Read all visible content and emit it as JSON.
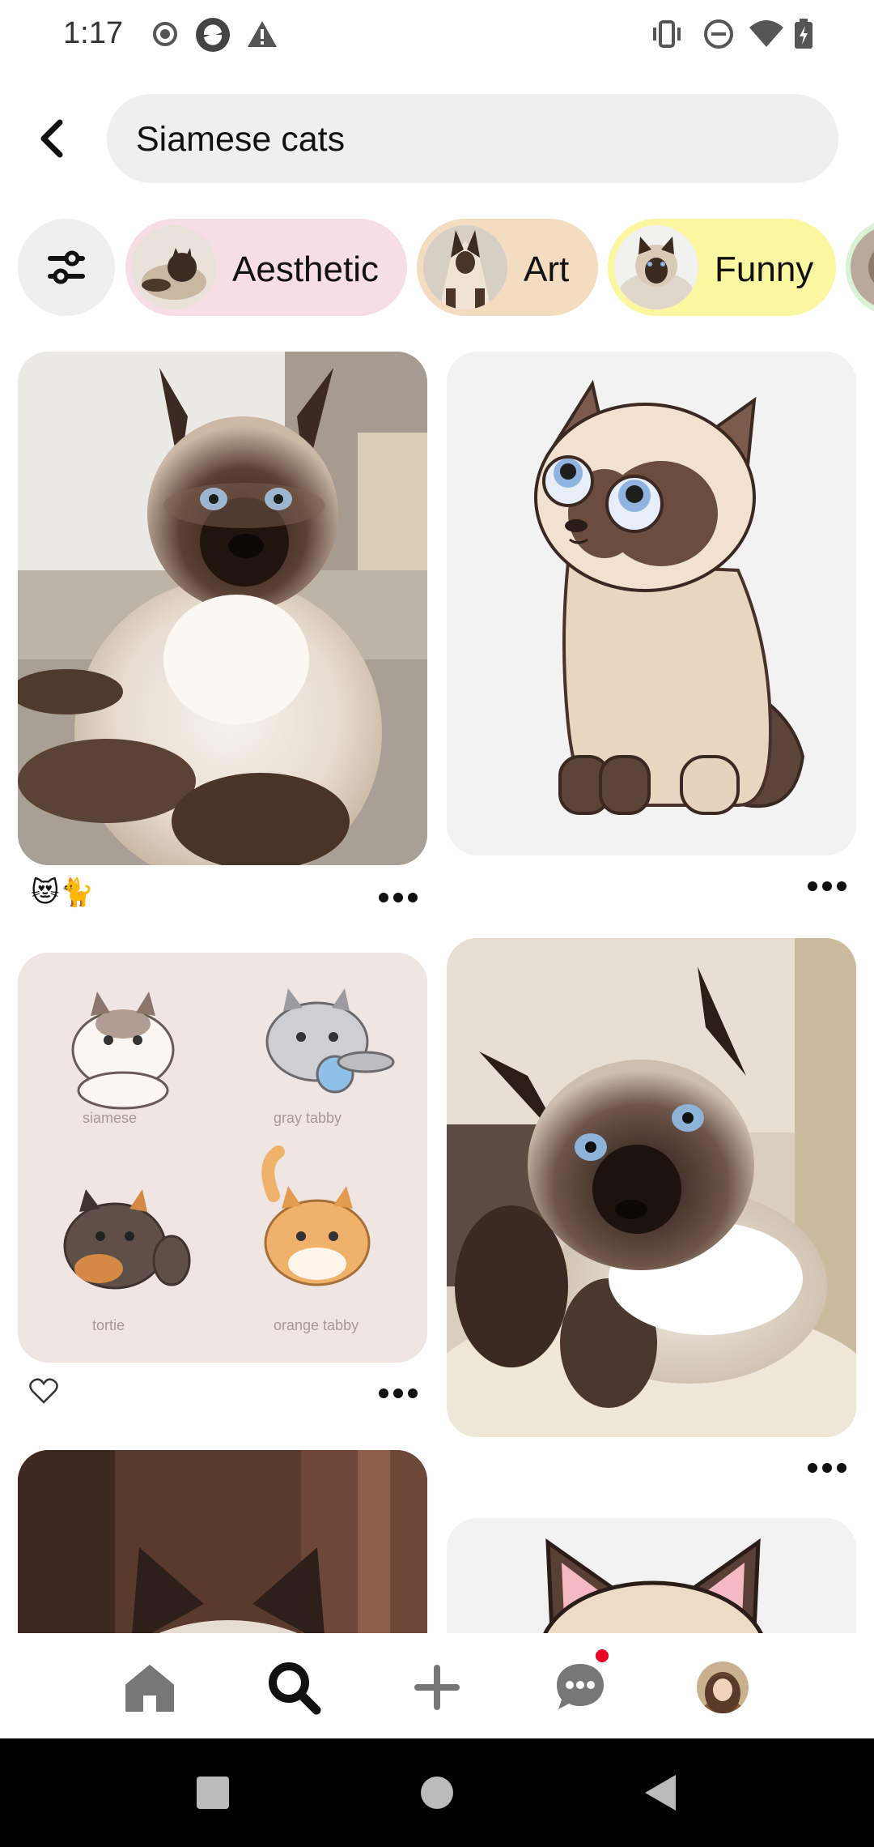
{
  "status_bar": {
    "time": "1:17",
    "left_icons": [
      "record-icon",
      "app-icon",
      "warning-icon"
    ],
    "right_icons": [
      "vibrate-icon",
      "do-not-disturb-icon",
      "wifi-icon",
      "battery-charging-icon"
    ]
  },
  "search": {
    "query": "Siamese cats",
    "back_icon": "chevron-left-icon"
  },
  "chips": [
    {
      "label": "Aesthetic",
      "bg": "#f7dde6"
    },
    {
      "label": "Art",
      "bg": "#f3dcc0"
    },
    {
      "label": "Funny",
      "bg": "#fbf6a0"
    },
    {
      "label": "",
      "bg": "#d9f2d2"
    }
  ],
  "feed": {
    "pins": [
      {
        "id": "pin-1",
        "footer_text": "😻🐈",
        "has_more": true
      },
      {
        "id": "pin-2",
        "footer_text": "",
        "has_more": true
      },
      {
        "id": "pin-3",
        "footer_icon": "heart-outline-icon",
        "has_more": true,
        "panel_labels": [
          "siamese",
          "gray tabby",
          "tortie",
          "orange tabby"
        ]
      },
      {
        "id": "pin-4",
        "footer_text": "",
        "has_more": true
      },
      {
        "id": "pin-5"
      },
      {
        "id": "pin-6"
      }
    ]
  },
  "bottom_nav": {
    "items": [
      "home-icon",
      "search-icon",
      "create-icon",
      "messages-icon",
      "profile-avatar"
    ],
    "active": "search-icon",
    "messages_has_notification": true
  },
  "system_nav": [
    "recents-icon",
    "home-circle-icon",
    "back-triangle-icon"
  ],
  "colors": {
    "accent": "#e60023",
    "surface": "#efefef",
    "text": "#111111"
  }
}
